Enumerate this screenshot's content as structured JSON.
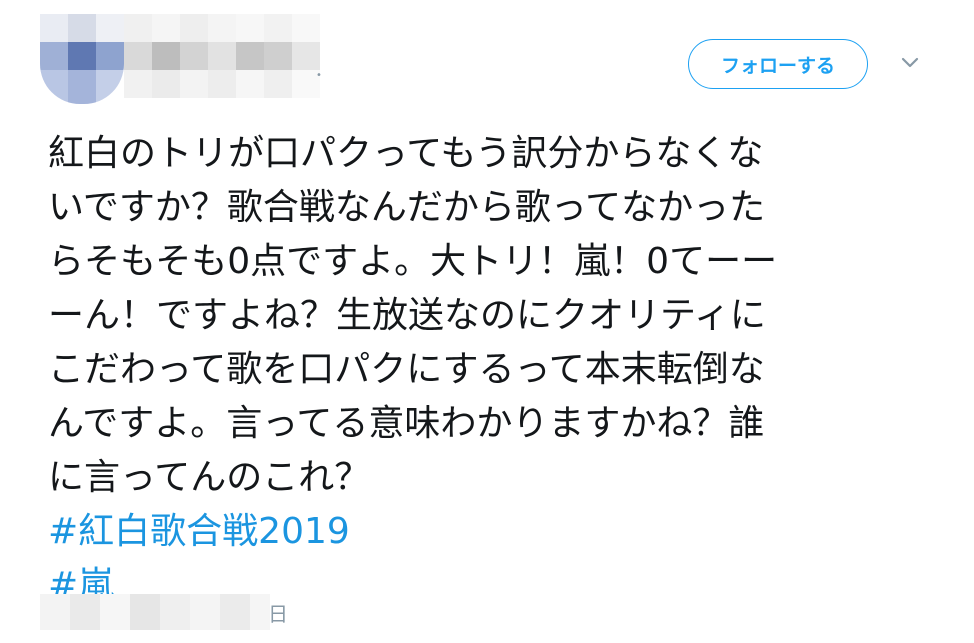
{
  "header": {
    "follow_label": "フォローする"
  },
  "tweet": {
    "lines": [
      "紅白のトリが口パクってもう訳分からなくな",
      "いですか？歌合戦なんだから歌ってなかった",
      "らそもそも0点ですよ。大トリ！嵐！0てーー",
      "ーん！ですよね？生放送なのにクオリティに",
      "こだわって歌を口パクにするって本末転倒な",
      "んですよ。言ってる意味わかりますかね？誰",
      "に言ってんのこれ？"
    ],
    "hashtags": [
      "#紅白歌合戦2019",
      "#嵐"
    ]
  },
  "footer": {
    "date_suffix": "日"
  },
  "colors": {
    "accent": "#1da1f2",
    "hashtag": "#1b95e0",
    "text": "#14171a",
    "muted": "#8899a6"
  },
  "icons": {
    "menu": "chevron-down-icon"
  }
}
